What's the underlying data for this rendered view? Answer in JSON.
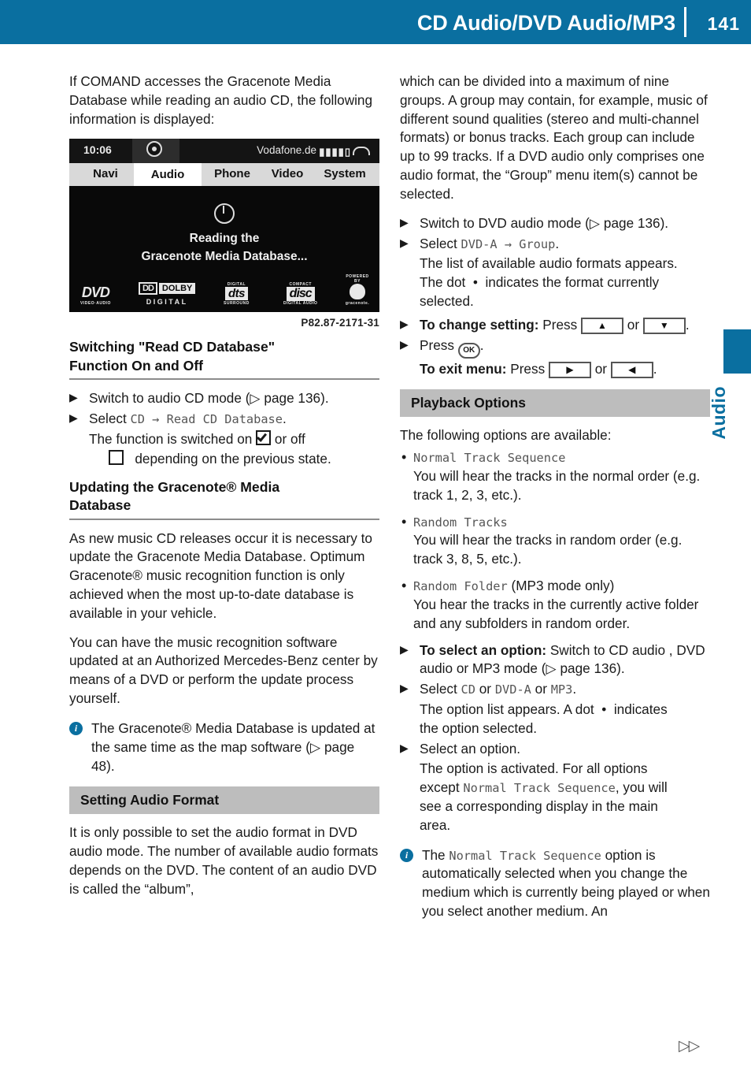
{
  "header": {
    "title": "CD Audio/DVD Audio/MP3",
    "page_number": "141"
  },
  "side_tab": {
    "label": "Audio"
  },
  "footer": {
    "arrows": "▷▷"
  },
  "left_column": {
    "intro": "If COMAND accesses the Gracenote Media Database while reading an audio CD, the following information is displayed:",
    "screen": {
      "clock": "10:06",
      "carrier": "Vodafone.de",
      "signal": "▮▮▮▮▯",
      "menu": [
        "Navi",
        "Audio",
        "Phone",
        "Video",
        "System"
      ],
      "active_menu": "Audio",
      "message_line1": "Reading the",
      "message_line2": "Gracenote Media Database...",
      "logos": [
        {
          "name": "dvd",
          "main": "DVD",
          "sub": "VIDEO·AUDIO"
        },
        {
          "name": "dolby",
          "mark": "DD",
          "word": "DOLBY",
          "under": "DIGITAL"
        },
        {
          "name": "dts",
          "top": "DIGITAL",
          "main": "dts",
          "sub": "SURROUND"
        },
        {
          "name": "compact-disc",
          "top": "COMPACT",
          "main": "disc",
          "sub": "DIGITAL AUDIO"
        },
        {
          "name": "gracenote",
          "top": "POWERED BY",
          "sub": "gracenote."
        }
      ],
      "caption": "P82.87-2171-31"
    },
    "heading1_line1": "Switching \"Read CD Database\"",
    "heading1_line2": "Function On and Off",
    "step1": "Switch to audio CD mode (▷ page 136).",
    "step2_prefix": "Select ",
    "step2_mono1": "CD",
    "step2_arrow": " → ",
    "step2_mono2": "Read CD Database",
    "step2_suffix": ".",
    "step2_result_a": "The function is switched on",
    "step2_result_b": "or off",
    "step2_result_c": "depending on the previous state.",
    "heading2_line1": "Updating the Gracenote® Media",
    "heading2_line2": "Database",
    "para1": "As new music CD releases occur it is necessary to update the Gracenote Media Database. Optimum Gracenote® music recognition function is only achieved when the most up-to-date database is available in your vehicle.",
    "para2": "You can have the music recognition software updated at an Authorized Mercedes-Benz center by means of a DVD or perform the update process yourself.",
    "note1": "The Gracenote® Media Database is updated at the same time as the map software (▷ page 48).",
    "section_band": "Setting Audio Format",
    "para3": "It is only possible to set the audio format in DVD audio mode. The number of available audio formats depends on the DVD. The content of an audio DVD is called the “album”,"
  },
  "right_column": {
    "para1": "which can be divided into a maximum of nine groups. A group may contain, for example, music of different sound qualities (stereo and multi-channel formats) or bonus tracks. Each group can include up to 99 tracks. If a DVD audio only comprises one audio format, the “Group” menu item(s) cannot be selected.",
    "step1": "Switch to DVD audio mode (▷ page 136).",
    "step2_prefix": "Select ",
    "step2_mono1": "DVD-A",
    "step2_arrow": " → ",
    "step2_mono2": "Group",
    "step2_suffix": ".",
    "step2_result_a": "The list of available audio formats appears.",
    "step2_result_b1": "The dot",
    "step2_result_b2": "indicates the format currently",
    "step2_result_c": "selected.",
    "step3_bold": "To change setting:",
    "step3_text": " Press ",
    "step3_key_up": "▲",
    "step3_or": " or ",
    "step3_key_down": "▼",
    "step3_end": ".",
    "step4_text": "Press ",
    "step4_ok": "OK",
    "step4_end": ".",
    "step4_bold": "To exit menu:",
    "step4_text2": " Press ",
    "step4_key_right": "▶",
    "step4_or": " or ",
    "step4_key_left": "◀",
    "step4_end2": ".",
    "section_band": "Playback Options",
    "para2": "The following options are available:",
    "options": [
      {
        "name": "Normal Track Sequence",
        "suffix": "",
        "desc": "You will hear the tracks in the normal order (e.g. track 1, 2, 3, etc.)."
      },
      {
        "name": "Random Tracks",
        "suffix": "",
        "desc": "You will hear the tracks in random order (e.g. track 3, 8, 5, etc.)."
      },
      {
        "name": "Random Folder",
        "suffix": " (MP3 mode only)",
        "desc": "You hear the tracks in the currently active folder and any subfolders in random order."
      }
    ],
    "step5_bold": "To select an option:",
    "step5_text": " Switch to CD audio , DVD audio or MP3 mode (▷ page 136).",
    "step6_prefix": "Select ",
    "step6_mono1": "CD",
    "step6_or1": " or ",
    "step6_mono2": "DVD-A",
    "step6_or2": " or ",
    "step6_mono3": "MP3",
    "step6_suffix": ".",
    "step6_result_a1": "The option list appears. A dot",
    "step6_result_a2": "indicates",
    "step6_result_b": "the option selected.",
    "step7": "Select an option.",
    "step7_result_a": "The option is activated. For all options",
    "step7_result_b_pre": "except ",
    "step7_result_b_mono": "Normal Track Sequence",
    "step7_result_b_post": ", you will",
    "step7_result_c": "see a corresponding display in the main",
    "step7_result_d": "area.",
    "note1_pre": "The ",
    "note1_mono": "Normal Track Sequence",
    "note1_post": " option is automatically selected when you change the medium which is currently being played or when you select another medium. An"
  }
}
